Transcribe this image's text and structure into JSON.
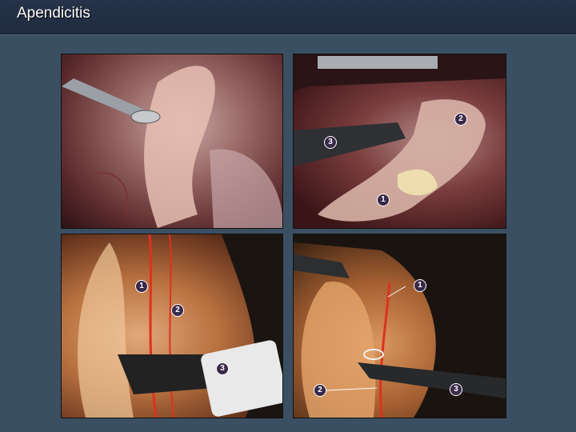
{
  "header": {
    "title": "Apendicitis"
  },
  "panels": [
    {
      "markers": []
    },
    {
      "markers": [
        "1",
        "2",
        "3"
      ]
    },
    {
      "markers": [
        "1",
        "2",
        "3"
      ]
    },
    {
      "markers": [
        "1",
        "2",
        "3"
      ]
    }
  ],
  "colors": {
    "background": "#3b4f63",
    "titlebar": "#222d41",
    "vessel": "#e0301e"
  }
}
